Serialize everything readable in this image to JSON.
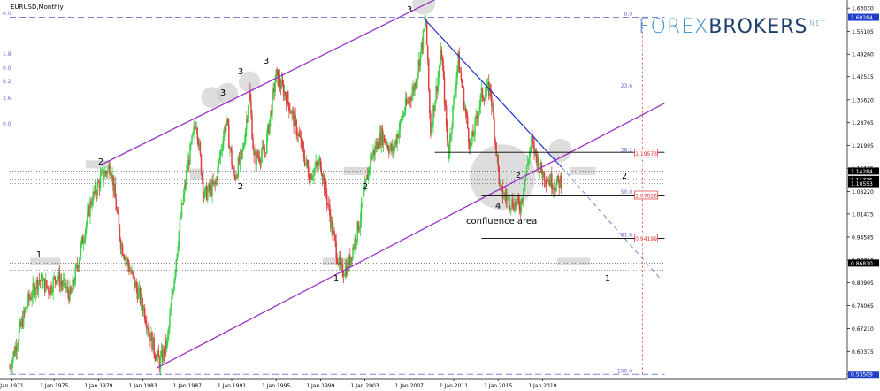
{
  "header": {
    "symbol_label": "EURUSD,Monthly"
  },
  "watermark": {
    "part1": "FOREX",
    "part2": "BROKERS",
    "suffix": ".NET"
  },
  "colors": {
    "bull": "#3cd24a",
    "bear": "#e04040",
    "channel": "#9b30c8",
    "trendline": "#1e2fd0",
    "projection": "#7a82d8",
    "fibo": "#6a6fd8",
    "label_box": "#e8e8e8",
    "price_tag": "#1e40c8",
    "fibo_tag": "#e03030"
  },
  "chart_data": {
    "type": "candlestick",
    "symbol": "EURUSD",
    "timeframe": "Monthly",
    "y_range": [
      0.5225,
      1.6545
    ],
    "x_range": [
      1970.75,
      2025.2
    ],
    "y_ticks": [
      "1.63030",
      "1.56105",
      "1.49260",
      "1.42515",
      "1.35620",
      "1.28765",
      "1.21995",
      "1.15135",
      "1.08220",
      "1.01475",
      "0.94585",
      "0.87710",
      "0.80905",
      "0.74065",
      "0.67210",
      "0.60375",
      "0.53509"
    ],
    "x_ticks": [
      "Jan 1971",
      "1 Jan 1975",
      "1 Jan 1979",
      "1 Jan 1983",
      "1 Jan 1987",
      "1 Jan 1991",
      "1 Jan 1995",
      "1 Jan 1999",
      "1 Jan 2003",
      "1 Jan 2007",
      "1 Jan 2011",
      "1 Jan 2015",
      "1 Jan 2019"
    ],
    "price_path": [
      [
        1971,
        0.555
      ],
      [
        1972.6,
        0.75
      ],
      [
        1973.6,
        0.82
      ],
      [
        1974.6,
        0.79
      ],
      [
        1975.2,
        0.83
      ],
      [
        1976.5,
        0.77
      ],
      [
        1978.3,
        1.05
      ],
      [
        1979.2,
        1.12
      ],
      [
        1980.1,
        1.16
      ],
      [
        1981.0,
        0.93
      ],
      [
        1982.0,
        0.83
      ],
      [
        1983.0,
        0.74
      ],
      [
        1984.0,
        0.61
      ],
      [
        1984.5,
        0.57
      ],
      [
        1985.2,
        0.63
      ],
      [
        1986.2,
        0.95
      ],
      [
        1987.0,
        1.15
      ],
      [
        1987.8,
        1.3
      ],
      [
        1988.5,
        1.07
      ],
      [
        1989.5,
        1.1
      ],
      [
        1990.5,
        1.3
      ],
      [
        1991.2,
        1.12
      ],
      [
        1992.0,
        1.2
      ],
      [
        1992.6,
        1.38
      ],
      [
        1993.0,
        1.18
      ],
      [
        1994.0,
        1.2
      ],
      [
        1995.0,
        1.43
      ],
      [
        1996.0,
        1.36
      ],
      [
        1997.0,
        1.25
      ],
      [
        1998.0,
        1.13
      ],
      [
        1999.0,
        1.17
      ],
      [
        2000.0,
        0.98
      ],
      [
        2000.8,
        0.84
      ],
      [
        2001.5,
        0.86
      ],
      [
        2002.5,
        0.99
      ],
      [
        2003.5,
        1.18
      ],
      [
        2004.5,
        1.25
      ],
      [
        2005.5,
        1.2
      ],
      [
        2006.5,
        1.32
      ],
      [
        2007.5,
        1.4
      ],
      [
        2008.5,
        1.59
      ],
      [
        2008.9,
        1.26
      ],
      [
        2009.9,
        1.5
      ],
      [
        2010.5,
        1.19
      ],
      [
        2011.4,
        1.48
      ],
      [
        2012.5,
        1.21
      ],
      [
        2013.5,
        1.37
      ],
      [
        2014.3,
        1.39
      ],
      [
        2015.2,
        1.08
      ],
      [
        2016.2,
        1.05
      ],
      [
        2017.0,
        1.04
      ],
      [
        2018.0,
        1.23
      ],
      [
        2018.9,
        1.14
      ],
      [
        2020.2,
        1.1
      ],
      [
        2020.8,
        1.12
      ]
    ],
    "levels": {
      "high": "1.60284",
      "mid_high": "1.14284",
      "current_a": "1.11775",
      "current_b": "1.10553",
      "low_band": "0.86810",
      "low": "0.53509"
    },
    "fibonacci": [
      {
        "ratio": "0.0",
        "price": 1.602
      },
      {
        "ratio": "23.6",
        "price": 1.388
      },
      {
        "ratio": "38.2",
        "price": 1.195,
        "tag": "1.19573"
      },
      {
        "ratio": "50.0",
        "price": 1.07,
        "tag": "1.07026"
      },
      {
        "ratio": "61.8",
        "price": 0.942,
        "tag": "0.94199"
      },
      {
        "ratio": "100.0",
        "price": 0.535
      }
    ],
    "left_cut_labels": [
      "0.0",
      "1.8",
      "0.0",
      "8.2",
      "3.6",
      "0.0"
    ],
    "wave_labels": [
      "1",
      "2",
      "3",
      "3",
      "3",
      "3",
      "2",
      "1",
      "2",
      "4",
      "2",
      "2",
      "1"
    ],
    "annotations": [
      "confluence area"
    ]
  }
}
